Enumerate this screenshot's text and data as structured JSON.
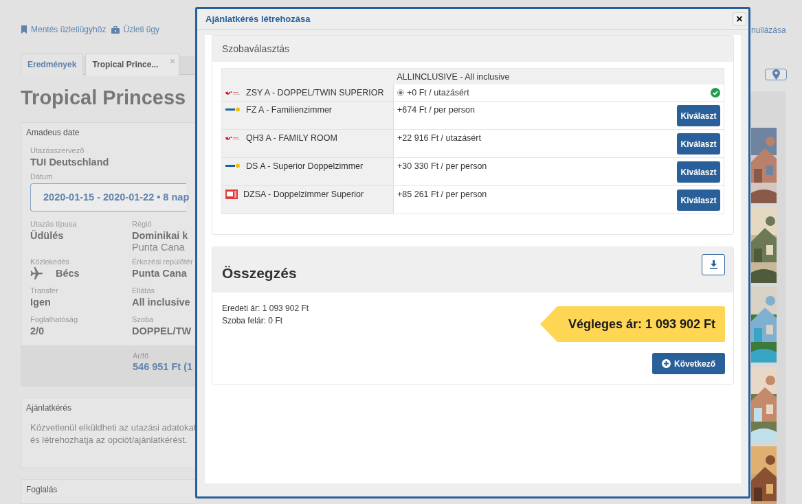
{
  "page": {
    "links": [
      {
        "label": "Mentés üzletiügyhöz",
        "kind": "bookmark"
      },
      {
        "label": "Üzleti ügy",
        "kind": "briefcase"
      }
    ],
    "tabs": [
      {
        "label": "Eredmények",
        "selected": false
      },
      {
        "label": "Tropical Prince...",
        "selected": true,
        "close": "×"
      }
    ],
    "title": "Tropical Princess",
    "details_card": {
      "title": "Amadeus date",
      "operator": {
        "label": "Utazásszervező",
        "value": "TUI Deutschland"
      },
      "date": {
        "label": "Dátum",
        "value": "2020-01-15 - 2020-01-22 • 8 nap"
      },
      "fields": [
        {
          "label": "Utazás típusa",
          "value": "Üdülés",
          "kind": "plain"
        },
        {
          "label": "Régió",
          "value": "Dominikai k",
          "sub": "Punta Cana",
          "kind": "plain"
        },
        {
          "label": "Közlekedés",
          "value": "Bécs",
          "kind": "transport"
        },
        {
          "label": "Érkezési repülőtér",
          "value": "Punta Cana",
          "kind": "plain"
        },
        {
          "label": "Transfer",
          "value": "Igen",
          "kind": "plain"
        },
        {
          "label": "Ellátás",
          "value": "All inclusive",
          "kind": "plain"
        },
        {
          "label": "Foglalhatóság",
          "value": "2/0",
          "kind": "plain"
        },
        {
          "label": "Szoba",
          "value": "DOPPEL/TW",
          "kind": "plain"
        }
      ],
      "price": {
        "label": "Ár/fő",
        "value": "546 951 Ft (1"
      }
    },
    "offer_card": {
      "title": "Ajánlatkérés",
      "lines": [
        "Közvetlenül elküldheti az utazási adatokat",
        "és létrehozhatja az opciót/ajánlatkérést."
      ]
    },
    "booking_card": {
      "title": "Foglalás"
    },
    "cancel_link": "nullázása"
  },
  "modal": {
    "title": "Ajánlatkérés létrehozása",
    "close": "×",
    "room_section": {
      "title": "Szobaválasztás",
      "board": "ALLINCLUSIVE - All inclusive",
      "rooms": [
        {
          "kind": "tui",
          "name": "ZSY A - DOPPEL/TWIN SUPERIOR",
          "price": "+0 Ft / utazásért",
          "selected": true
        },
        {
          "kind": "vtours",
          "name": "FZ A - Familienzimmer",
          "price": "+674 Ft / per person",
          "selected": false,
          "button": "Kiválaszt"
        },
        {
          "kind": "tui",
          "name": "QH3 A - FAMILY ROOM",
          "price": "+22 916 Ft / utazásért",
          "selected": false,
          "button": "Kiválaszt"
        },
        {
          "kind": "vtours",
          "name": "DS A - Superior Doppelzimmer",
          "price": "+30 330 Ft / per person",
          "selected": false,
          "button": "Kiválaszt"
        },
        {
          "kind": "its",
          "name": "DZSA - Doppelzimmer Superior",
          "price": "+85 261 Ft / per person",
          "selected": false,
          "button": "Kiválaszt"
        }
      ]
    },
    "summary": {
      "title": "Összegzés",
      "lines": [
        "Eredeti ár: 1 093 902 Ft",
        "Szoba felár: 0 Ft"
      ],
      "final_price": "Végleges ár: 1 093 902 Ft",
      "next_button": "Következő"
    }
  }
}
